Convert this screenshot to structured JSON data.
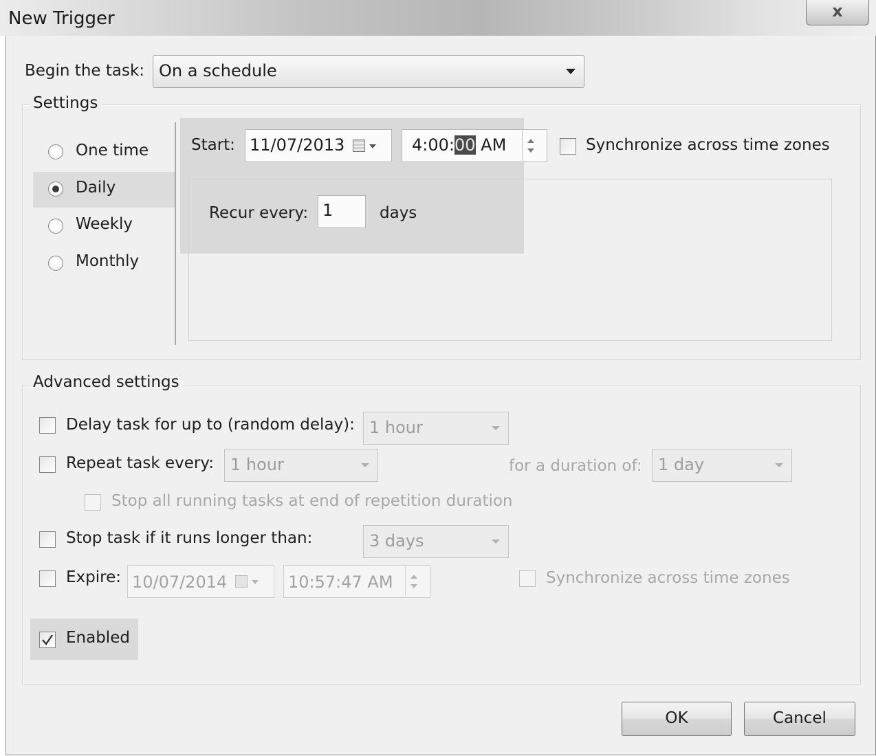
{
  "window": {
    "title": "New Trigger",
    "close_label": "x"
  },
  "begin": {
    "label": "Begin the task:",
    "value": "On a schedule"
  },
  "settings": {
    "legend": "Settings",
    "options": [
      "One time",
      "Daily",
      "Weekly",
      "Monthly"
    ],
    "selected": "Daily",
    "start_label": "Start:",
    "start_date": "11/07/2013",
    "start_time_before": "4:00:",
    "start_time_selected": "00",
    "start_time_after": " AM",
    "sync_label": "Synchronize across time zones",
    "recur_label": "Recur every:",
    "recur_value": "1",
    "recur_unit": "days"
  },
  "advanced": {
    "legend": "Advanced settings",
    "delay_label": "Delay task for up to (random delay):",
    "delay_value": "1 hour",
    "repeat_label": "Repeat task every:",
    "repeat_value": "1 hour",
    "duration_label": "for a duration of:",
    "duration_value": "1 day",
    "stop_all_label": "Stop all running tasks at end of repetition duration",
    "stop_if_label": "Stop task if it runs longer than:",
    "stop_if_value": "3 days",
    "expire_label": "Expire:",
    "expire_date": "10/07/2014",
    "expire_time": "10:57:47 AM",
    "expire_sync_label": "Synchronize across time zones",
    "enabled_label": "Enabled",
    "enabled_checked": true
  },
  "buttons": {
    "ok": "OK",
    "cancel": "Cancel"
  }
}
